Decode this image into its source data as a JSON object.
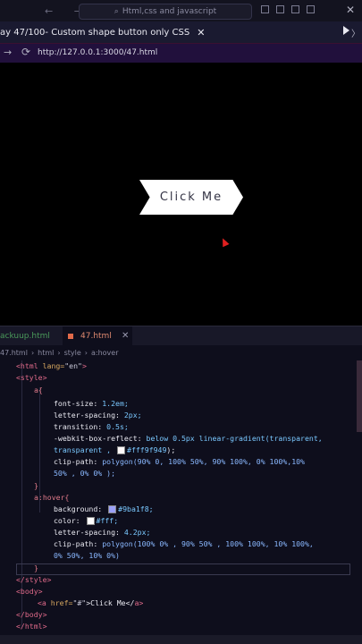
{
  "titlebar": {
    "nav_arrows": "← →",
    "search_text": "Html,css and javascript"
  },
  "browser": {
    "tab_title": "ay 47/100- Custom shape button only CSS",
    "tab_close": "✕",
    "url": "http://127.0.0.1:3000/47.html"
  },
  "preview": {
    "button_label": "Click Me"
  },
  "editor": {
    "tabs": [
      {
        "label": "ackuup.html"
      },
      {
        "label": "47.html",
        "close": "✕"
      }
    ],
    "breadcrumb": [
      "47.html",
      "›",
      "html",
      "›",
      "style",
      "›",
      "a:hover"
    ],
    "code": {
      "l1_open": "<html",
      "l1_attr": " lang=",
      "l1_str": "\"en\"",
      "l1_close": ">",
      "l2": "<style>",
      "l3": "a{",
      "l4_prop": "font-size: ",
      "l4_val": "1.2em;",
      "l5_prop": "letter-spacing: ",
      "l5_val": "2px;",
      "l6_prop": "transition: ",
      "l6_val": "0.5s;",
      "l7_prop": "-webkit-box-reflect: ",
      "l7_val": "below 0.5px linear-gradient(transparent,",
      "l8_val": "transparent , ",
      "l8_color": "#fff9f949",
      "l8_end": ");",
      "l9_prop": "clip-path: ",
      "l9_val": "polygon(90% 0, 100% 50%, 90% 100%, 0% 100%,10%",
      "l10_val": "50% , 0% 0% );",
      "l11": "}",
      "l12": "a:hover{",
      "l13_prop": "background: ",
      "l13_val": "#9ba1f8;",
      "l14_prop": "color: ",
      "l14_val": "#fff;",
      "l15_prop": "letter-spacing: ",
      "l15_val": "4.2px;",
      "l16_prop": "clip-path: ",
      "l16_val": "polygon(100% 0% , 90% 50% , 100% 100%, 10% 100%,",
      "l17_val": "0% 50%, 10% 0%)",
      "l18": "}",
      "l19": "</style>",
      "l20": "<body>",
      "l21_open": "<a",
      "l21_attr": " href=",
      "l21_str": "\"#\"",
      "l21_text": ">Click Me</",
      "l21_close": "a>",
      "l22": "</body>",
      "l23": "</html>"
    }
  },
  "colors": {
    "swatch_reflect": "#fff9f9",
    "swatch_hover_bg": "#9ba1f8",
    "swatch_white": "#ffffff"
  }
}
